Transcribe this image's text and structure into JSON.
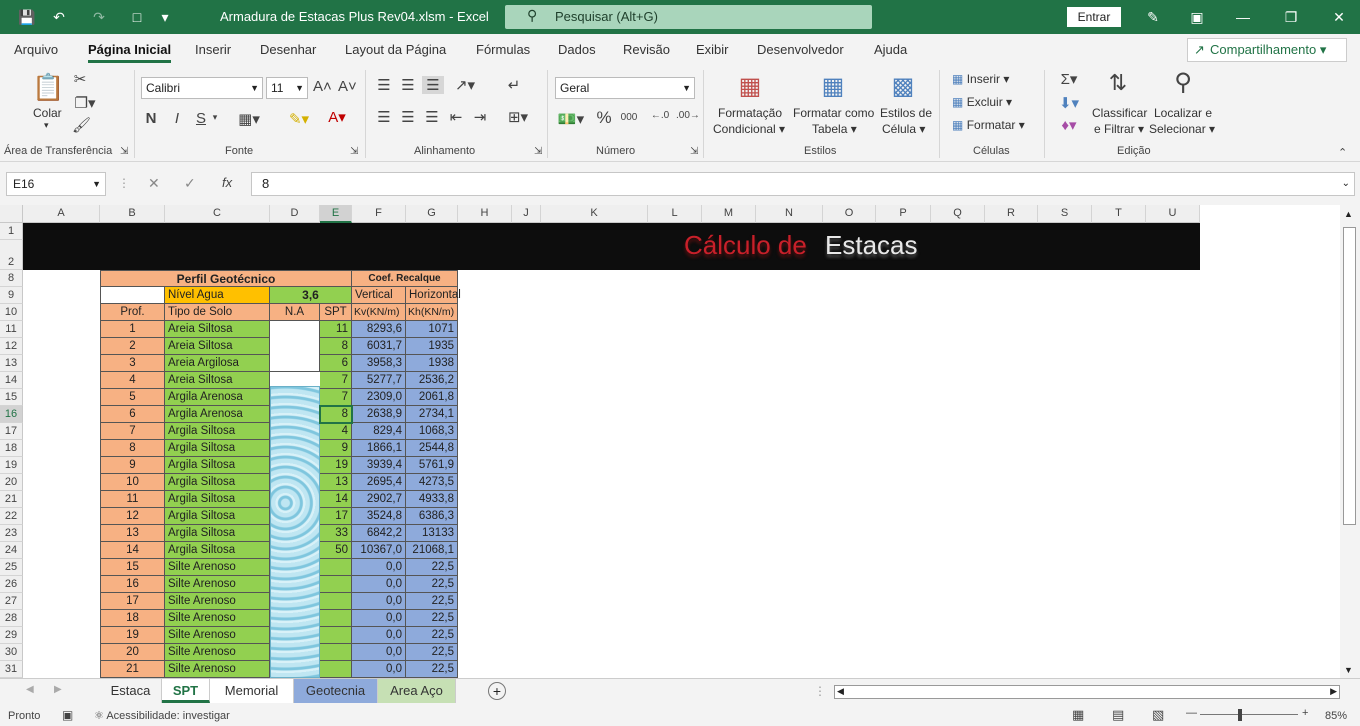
{
  "titlebar": {
    "filename": "Armadura de Estacas Plus Rev04.xlsm",
    "sep": "-",
    "app": "Excel",
    "search_placeholder": "Pesquisar (Alt+G)",
    "signin": "Entrar"
  },
  "menu": {
    "tabs": [
      "Arquivo",
      "Página Inicial",
      "Inserir",
      "Desenhar",
      "Layout da Página",
      "Fórmulas",
      "Dados",
      "Revisão",
      "Exibir",
      "Desenvolvedor",
      "Ajuda"
    ],
    "active": "Página Inicial",
    "share": "Compartilhamento"
  },
  "ribbon": {
    "clipboard": {
      "paste": "Colar",
      "label": "Área de Transferência"
    },
    "font": {
      "name": "Calibri",
      "size": "11",
      "bold": "N",
      "italic": "I",
      "underline": "S",
      "label": "Fonte"
    },
    "alignment": {
      "label": "Alinhamento"
    },
    "number": {
      "format": "Geral",
      "label": "Número",
      "percent": "%",
      "thousands": "000"
    },
    "styles": {
      "cond1": "Formatação",
      "cond2": "Condicional",
      "table1": "Formatar como",
      "table2": "Tabela",
      "cell1": "Estilos de",
      "cell2": "Célula",
      "label": "Estilos"
    },
    "cells": {
      "insert": "Inserir",
      "delete": "Excluir",
      "format": "Formatar",
      "label": "Células"
    },
    "editing": {
      "sort1": "Classificar",
      "sort2": "e Filtrar",
      "find1": "Localizar e",
      "find2": "Selecionar",
      "label": "Edição"
    }
  },
  "formula_bar": {
    "namebox": "E16",
    "fx": "fx",
    "value": "8"
  },
  "columns": [
    "A",
    "B",
    "C",
    "D",
    "E",
    "F",
    "G",
    "H",
    "J",
    "K",
    "L",
    "M",
    "N",
    "O",
    "P",
    "Q",
    "R",
    "S",
    "T",
    "U"
  ],
  "row_numbers": [
    "1",
    "2",
    "8",
    "9",
    "10",
    "11",
    "12",
    "13",
    "14",
    "15",
    "16",
    "17",
    "18",
    "19",
    "20",
    "21",
    "22",
    "23",
    "24",
    "25",
    "26",
    "27",
    "28",
    "29",
    "30",
    "31"
  ],
  "banner": {
    "part1": "Cálculo de",
    "part2": "Estacas"
  },
  "table": {
    "header_profile": "Perfil Geotécnico",
    "header_coef": "Coef. Recalque",
    "water_label": "Nível Agua",
    "water_value": "3,6",
    "vertical": "Vertical",
    "horizontal": "Horizontal",
    "col_prof": "Prof.",
    "col_soil": "Tipo de Solo",
    "col_na": "N.A",
    "col_spt": "SPT",
    "col_kv": "Kv(KN/m)",
    "col_kh": "Kh(KN/m)",
    "rows": [
      {
        "prof": "1",
        "soil": "Areia Siltosa",
        "spt": "11",
        "kv": "8293,6",
        "kh": "1071"
      },
      {
        "prof": "2",
        "soil": "Areia Siltosa",
        "spt": "8",
        "kv": "6031,7",
        "kh": "1935"
      },
      {
        "prof": "3",
        "soil": "Areia Argilosa",
        "spt": "6",
        "kv": "3958,3",
        "kh": "1938"
      },
      {
        "prof": "4",
        "soil": "Areia Siltosa",
        "spt": "7",
        "kv": "5277,7",
        "kh": "2536,2"
      },
      {
        "prof": "5",
        "soil": "Argila Arenosa",
        "spt": "7",
        "kv": "2309,0",
        "kh": "2061,8"
      },
      {
        "prof": "6",
        "soil": "Argila Arenosa",
        "spt": "8",
        "kv": "2638,9",
        "kh": "2734,1"
      },
      {
        "prof": "7",
        "soil": "Argila Siltosa",
        "spt": "4",
        "kv": "829,4",
        "kh": "1068,3"
      },
      {
        "prof": "8",
        "soil": "Argila Siltosa",
        "spt": "9",
        "kv": "1866,1",
        "kh": "2544,8"
      },
      {
        "prof": "9",
        "soil": "Argila Siltosa",
        "spt": "19",
        "kv": "3939,4",
        "kh": "5761,9"
      },
      {
        "prof": "10",
        "soil": "Argila Siltosa",
        "spt": "13",
        "kv": "2695,4",
        "kh": "4273,5"
      },
      {
        "prof": "11",
        "soil": "Argila Siltosa",
        "spt": "14",
        "kv": "2902,7",
        "kh": "4933,8"
      },
      {
        "prof": "12",
        "soil": "Argila Siltosa",
        "spt": "17",
        "kv": "3524,8",
        "kh": "6386,3"
      },
      {
        "prof": "13",
        "soil": "Argila Siltosa",
        "spt": "33",
        "kv": "6842,2",
        "kh": "13133"
      },
      {
        "prof": "14",
        "soil": "Argila Siltosa",
        "spt": "50",
        "kv": "10367,0",
        "kh": "21068,1"
      },
      {
        "prof": "15",
        "soil": "Silte Arenoso",
        "spt": "",
        "kv": "0,0",
        "kh": "22,5"
      },
      {
        "prof": "16",
        "soil": "Silte Arenoso",
        "spt": "",
        "kv": "0,0",
        "kh": "22,5"
      },
      {
        "prof": "17",
        "soil": "Silte Arenoso",
        "spt": "",
        "kv": "0,0",
        "kh": "22,5"
      },
      {
        "prof": "18",
        "soil": "Silte Arenoso",
        "spt": "",
        "kv": "0,0",
        "kh": "22,5"
      },
      {
        "prof": "19",
        "soil": "Silte Arenoso",
        "spt": "",
        "kv": "0,0",
        "kh": "22,5"
      },
      {
        "prof": "20",
        "soil": "Silte Arenoso",
        "spt": "",
        "kv": "0,0",
        "kh": "22,5"
      },
      {
        "prof": "21",
        "soil": "Silte Arenoso",
        "spt": "",
        "kv": "0,0",
        "kh": "22,5"
      }
    ]
  },
  "sheet_tabs": [
    {
      "label": "Estaca",
      "color": ""
    },
    {
      "label": "SPT",
      "color": "",
      "active": true
    },
    {
      "label": "Memorial",
      "color": "#ffffff"
    },
    {
      "label": "Geotecnia",
      "color": "#8eaadb"
    },
    {
      "label": "Area Aço",
      "color": "#c6e0b4"
    }
  ],
  "status": {
    "ready": "Pronto",
    "accessibility": "Acessibilidade: investigar",
    "zoom": "85%"
  }
}
